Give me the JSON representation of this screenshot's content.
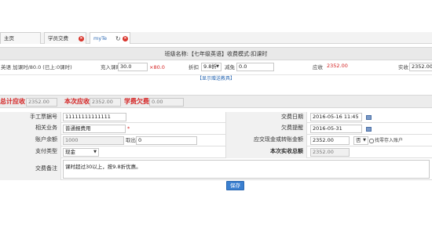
{
  "tabs": [
    {
      "label": "主页"
    },
    {
      "label": "学员交费"
    },
    {
      "label": "myTe"
    }
  ],
  "class_header": "班级名称:【七年级英语】收费模式:扣课时",
  "fee": {
    "course_label": "英语 加课时/80.0 (已上:0课时)",
    "buy_hours_label": "充入课时",
    "buy_hours_value": "30.0",
    "multiplier": "×80.0",
    "discount_label": "折扣",
    "discount_value": "9.8折",
    "reduce_label": "减免",
    "reduce_value": "0.0",
    "receivable_label": "应收",
    "receivable_value": "2352.00",
    "received_label": "实收",
    "received_value": "2352.00"
  },
  "show_gift_link": "【显示赠送教具】",
  "summary": {
    "total_label": "总计应收",
    "total_value": "2352.00",
    "current_label": "本次应收",
    "current_value": "2352.00",
    "owe_label": "学费欠费",
    "owe_value": "0.00"
  },
  "form": {
    "receipt_label": "手工票据号",
    "receipt_value": "11111111111111",
    "pay_date_label": "交费日期",
    "pay_date_value": "2016-05-16 11:45",
    "business_label": "相关业务",
    "business_value": "普通报费用",
    "required_mark": "*",
    "remind_label": "欠费提醒",
    "remind_value": "2016-05-31",
    "balance_label": "账户余额",
    "balance_value": "1000",
    "withdraw_label": "取出",
    "withdraw_value": "0",
    "cash_label": "应交现金或转账金额",
    "cash_value": "2352.00",
    "deposit_select": "否",
    "deposit_label": "找零存入账户",
    "pay_type_label": "支付类型",
    "pay_type_value": "现金",
    "actual_total_label": "本次实收总额",
    "actual_total_value": "2352.00",
    "note_label": "交费备注",
    "note_value": "课时超过30以上，按9.8折优惠。"
  },
  "save_label": "保存",
  "colors": {
    "accent_blue": "#3a7fd0",
    "red_text": "#d42323"
  }
}
